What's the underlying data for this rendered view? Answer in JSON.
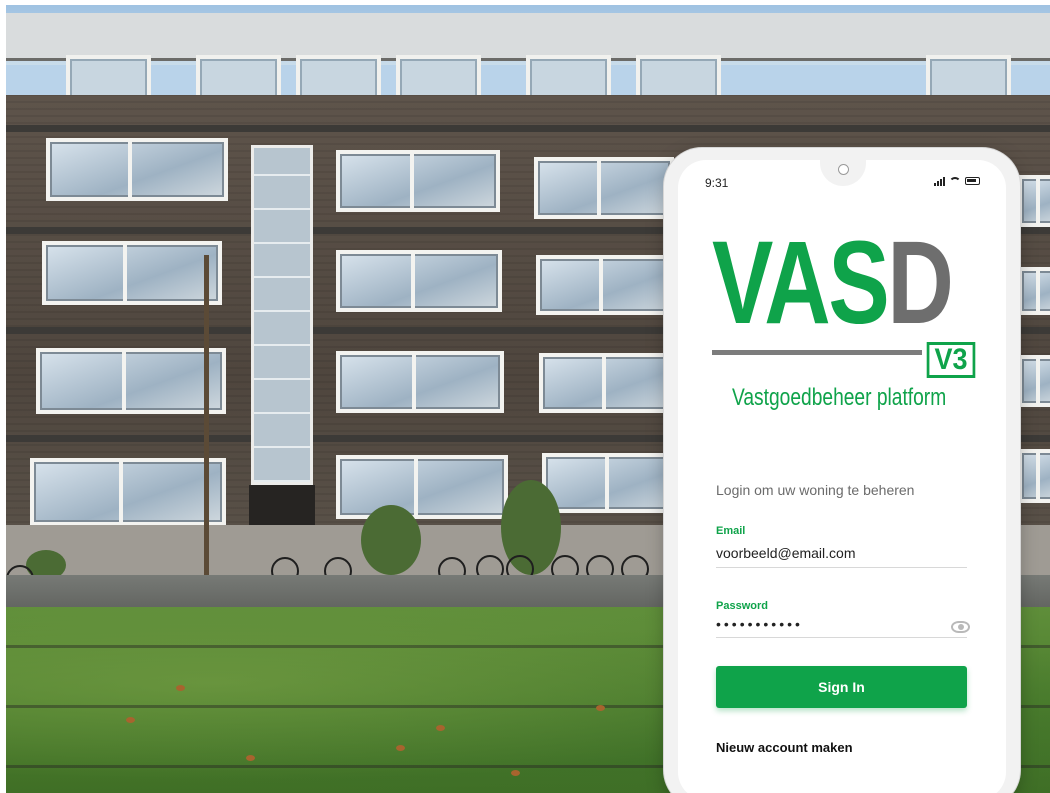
{
  "status_bar": {
    "time": "9:31"
  },
  "logo": {
    "main_green": "VAS",
    "main_grey": "D",
    "version_badge": "V3",
    "tagline": "Vastgoedbeheer platform"
  },
  "login": {
    "intro": "Login om uw woning te beheren",
    "email_label": "Email",
    "email_value": "voorbeeld@email.com",
    "password_label": "Password",
    "password_masked": "•••••••••••",
    "sign_in_label": "Sign In",
    "new_account_label": "Nieuw account maken"
  },
  "icons": {
    "signal": "signal-icon",
    "wifi": "wifi-icon",
    "battery": "battery-icon",
    "password_toggle": "eye-icon"
  },
  "colors": {
    "brand_green": "#0fa34a",
    "logo_grey": "#6e6e6e",
    "intro_text": "#6b6b6b"
  }
}
